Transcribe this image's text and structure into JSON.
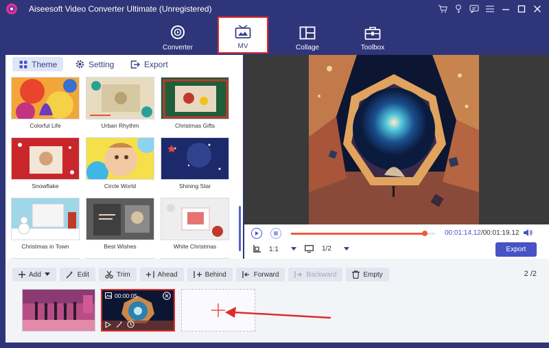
{
  "app": {
    "title": "Aiseesoft Video Converter Ultimate (Unregistered)",
    "accent": "#4752c4",
    "header_bg": "#2f3579",
    "highlight": "#e02b2b"
  },
  "window_icons": [
    "cart-icon",
    "key-icon",
    "feedback-icon",
    "menu-icon",
    "minimize-icon",
    "maximize-icon",
    "close-icon"
  ],
  "nav": {
    "tabs": [
      {
        "label": "Converter",
        "icon": "converter-icon"
      },
      {
        "label": "MV",
        "icon": "mv-icon",
        "active": true
      },
      {
        "label": "Collage",
        "icon": "collage-icon"
      },
      {
        "label": "Toolbox",
        "icon": "toolbox-icon"
      }
    ]
  },
  "subtabs": [
    {
      "label": "Theme",
      "icon": "theme-icon",
      "active": true
    },
    {
      "label": "Setting",
      "icon": "gear-icon"
    },
    {
      "label": "Export",
      "icon": "export-icon"
    }
  ],
  "themes": [
    {
      "label": "Colorful Life"
    },
    {
      "label": "Urban Rhythm"
    },
    {
      "label": "Christmas Gifts"
    },
    {
      "label": "Snowflake"
    },
    {
      "label": "Circle World"
    },
    {
      "label": "Shining Star"
    },
    {
      "label": "Christmas in Town"
    },
    {
      "label": "Best Wishes"
    },
    {
      "label": "White Christmas"
    }
  ],
  "player": {
    "current_time": "00:01:14.12",
    "separator": "/",
    "total_time": "00:01:19.12",
    "progress": 0.93,
    "aspect": "1:1",
    "zoom": "1/2",
    "export_label": "Export"
  },
  "toolbar": {
    "add": "Add",
    "edit": "Edit",
    "trim": "Trim",
    "ahead": "Ahead",
    "behind": "Behind",
    "forward": "Forward",
    "backward": "Backward",
    "empty": "Empty",
    "page": "2",
    "page_sep": "/",
    "page_total": "2"
  },
  "clips": {
    "selected_duration": "00:00:05"
  }
}
